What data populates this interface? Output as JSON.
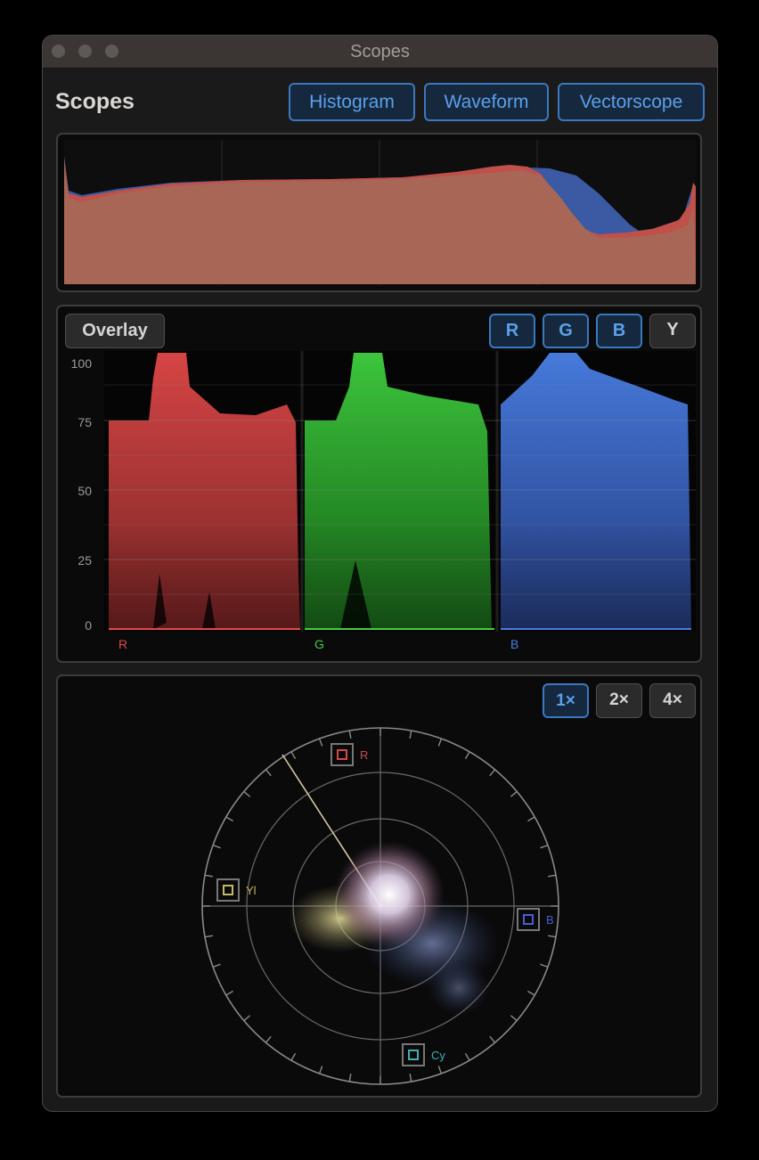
{
  "window": {
    "title": "Scopes"
  },
  "header": {
    "title": "Scopes",
    "modes": [
      {
        "label": "Histogram"
      },
      {
        "label": "Waveform"
      },
      {
        "label": "Vectorscope"
      }
    ]
  },
  "histogram": {
    "colors": {
      "red": "#c0504a",
      "green": "#3e9a5a",
      "blue": "#3b5aa3",
      "composite": "#a86656"
    }
  },
  "waveform": {
    "overlay_label": "Overlay",
    "channels": [
      {
        "label": "R",
        "active": true
      },
      {
        "label": "G",
        "active": true
      },
      {
        "label": "B",
        "active": true
      },
      {
        "label": "Y",
        "active": false
      }
    ],
    "y_axis": [
      "100",
      "75",
      "50",
      "25",
      "0"
    ],
    "parade_labels": [
      {
        "label": "R",
        "color": "#e04a4a"
      },
      {
        "label": "G",
        "color": "#44cc44"
      },
      {
        "label": "B",
        "color": "#4a7ce0"
      }
    ]
  },
  "vectorscope": {
    "zoom": [
      {
        "label": "1×",
        "active": true
      },
      {
        "label": "2×",
        "active": false
      },
      {
        "label": "4×",
        "active": false
      }
    ],
    "targets": [
      {
        "label": "R",
        "color": "#d04a4a"
      },
      {
        "label": "Yl",
        "color": "#c6b85e"
      },
      {
        "label": "B",
        "color": "#4a5cd0"
      },
      {
        "label": "Cy",
        "color": "#3fb0b0"
      }
    ]
  }
}
